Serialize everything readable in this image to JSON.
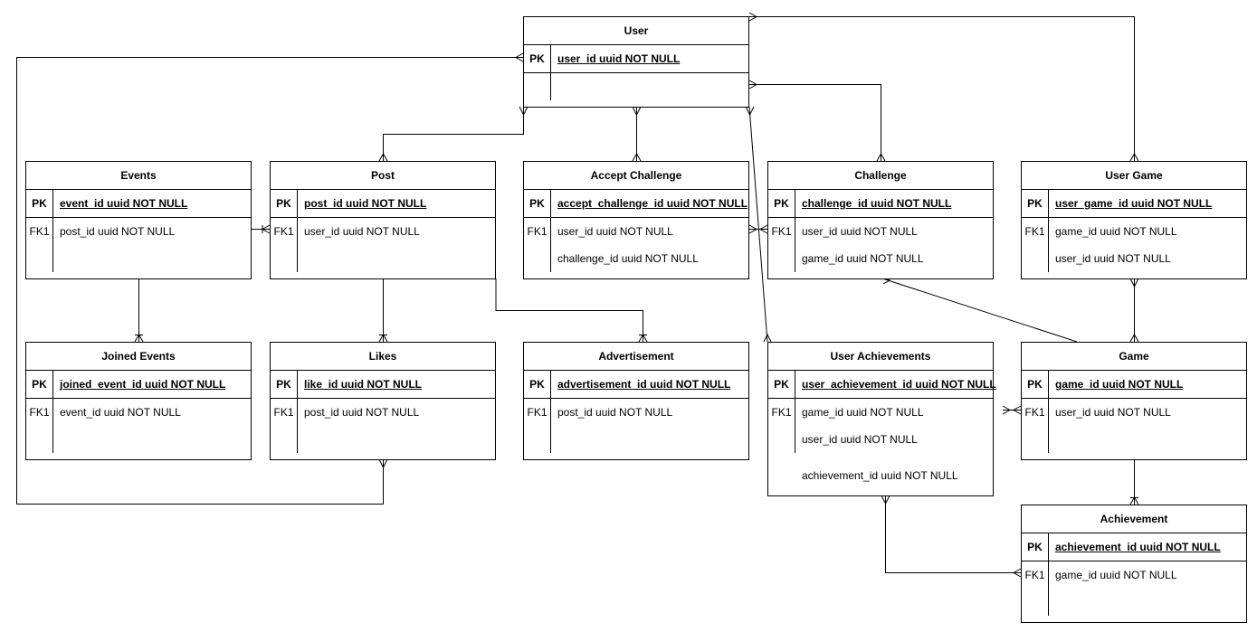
{
  "diagram": {
    "type": "entity-relationship",
    "entities": {
      "user": {
        "title": "User",
        "pk_label": "PK",
        "pk": "user_id uuid NOT NULL",
        "fk_label": "",
        "fields": []
      },
      "events": {
        "title": "Events",
        "pk_label": "PK",
        "pk": "event_id uuid NOT NULL",
        "fk_label": "FK1",
        "fields": [
          "post_id uuid NOT NULL"
        ]
      },
      "post": {
        "title": "Post",
        "pk_label": "PK",
        "pk": "post_id uuid NOT NULL",
        "fk_label": "FK1",
        "fields": [
          "user_id uuid NOT NULL"
        ]
      },
      "accept_challenge": {
        "title": "Accept Challenge",
        "pk_label": "PK",
        "pk": "accept_challenge_id uuid NOT NULL",
        "fk_label": "FK1",
        "fields": [
          "user_id uuid NOT NULL",
          "challenge_id uuid NOT NULL"
        ]
      },
      "challenge": {
        "title": "Challenge",
        "pk_label": "PK",
        "pk": "challenge_id uuid NOT NULL",
        "fk_label": "FK1",
        "fields": [
          "user_id uuid NOT NULL",
          "game_id uuid NOT NULL"
        ]
      },
      "user_game": {
        "title": "User Game",
        "pk_label": "PK",
        "pk": "user_game_id uuid NOT NULL",
        "fk_label": "FK1",
        "fields": [
          "game_id uuid NOT NULL",
          "user_id uuid NOT NULL"
        ]
      },
      "joined_events": {
        "title": "Joined Events",
        "pk_label": "PK",
        "pk": "joined_event_id uuid NOT NULL",
        "fk_label": "FK1",
        "fields": [
          "event_id uuid NOT NULL"
        ]
      },
      "likes": {
        "title": "Likes",
        "pk_label": "PK",
        "pk": "like_id uuid NOT NULL",
        "fk_label": "FK1",
        "fields": [
          "post_id uuid NOT NULL"
        ]
      },
      "advertisement": {
        "title": "Advertisement",
        "pk_label": "PK",
        "pk": "advertisement_id uuid NOT NULL",
        "fk_label": "FK1",
        "fields": [
          "post_id uuid NOT NULL"
        ]
      },
      "user_achievements": {
        "title": "User Achievements",
        "pk_label": "PK",
        "pk": "user_achievement_id uuid NOT NULL",
        "fk_label": "FK1",
        "fields": [
          "game_id uuid NOT NULL",
          "user_id uuid NOT NULL"
        ],
        "extra_field": "achievement_id uuid NOT NULL"
      },
      "game": {
        "title": "Game",
        "pk_label": "PK",
        "pk": "game_id uuid NOT NULL",
        "fk_label": "FK1",
        "fields": [
          "user_id uuid NOT NULL"
        ]
      },
      "achievement": {
        "title": "Achievement",
        "pk_label": "PK",
        "pk": "achievement_id uuid NOT NULL",
        "fk_label": "FK1",
        "fields": [
          "game_id uuid NOT NULL"
        ]
      }
    },
    "relationships": [
      {
        "from": "User",
        "to": "Post",
        "notation": "many"
      },
      {
        "from": "User",
        "to": "Accept Challenge",
        "notation": "many-to-many"
      },
      {
        "from": "User",
        "to": "Challenge",
        "notation": "many-to-many"
      },
      {
        "from": "User",
        "to": "User Game",
        "notation": "many-to-many"
      },
      {
        "from": "User",
        "to": "Likes",
        "notation": "many-to-many"
      },
      {
        "from": "User",
        "to": "User Achievements",
        "notation": "many-to-many"
      },
      {
        "from": "Events",
        "to": "Post",
        "notation": "one-to-many"
      },
      {
        "from": "Events",
        "to": "Joined Events",
        "notation": "one-to-many"
      },
      {
        "from": "Post",
        "to": "Likes",
        "notation": "one-to-many"
      },
      {
        "from": "Post",
        "to": "Advertisement",
        "notation": "one-to-many"
      },
      {
        "from": "Accept Challenge",
        "to": "Challenge",
        "notation": "many-to-many"
      },
      {
        "from": "Game",
        "to": "Challenge",
        "notation": "many"
      },
      {
        "from": "User Game",
        "to": "Game",
        "notation": "many-to-many"
      },
      {
        "from": "User Achievements",
        "to": "Game",
        "notation": "many-to-many"
      },
      {
        "from": "Game",
        "to": "Achievement",
        "notation": "one-to-many"
      },
      {
        "from": "User Achievements",
        "to": "Achievement",
        "notation": "many"
      }
    ]
  }
}
